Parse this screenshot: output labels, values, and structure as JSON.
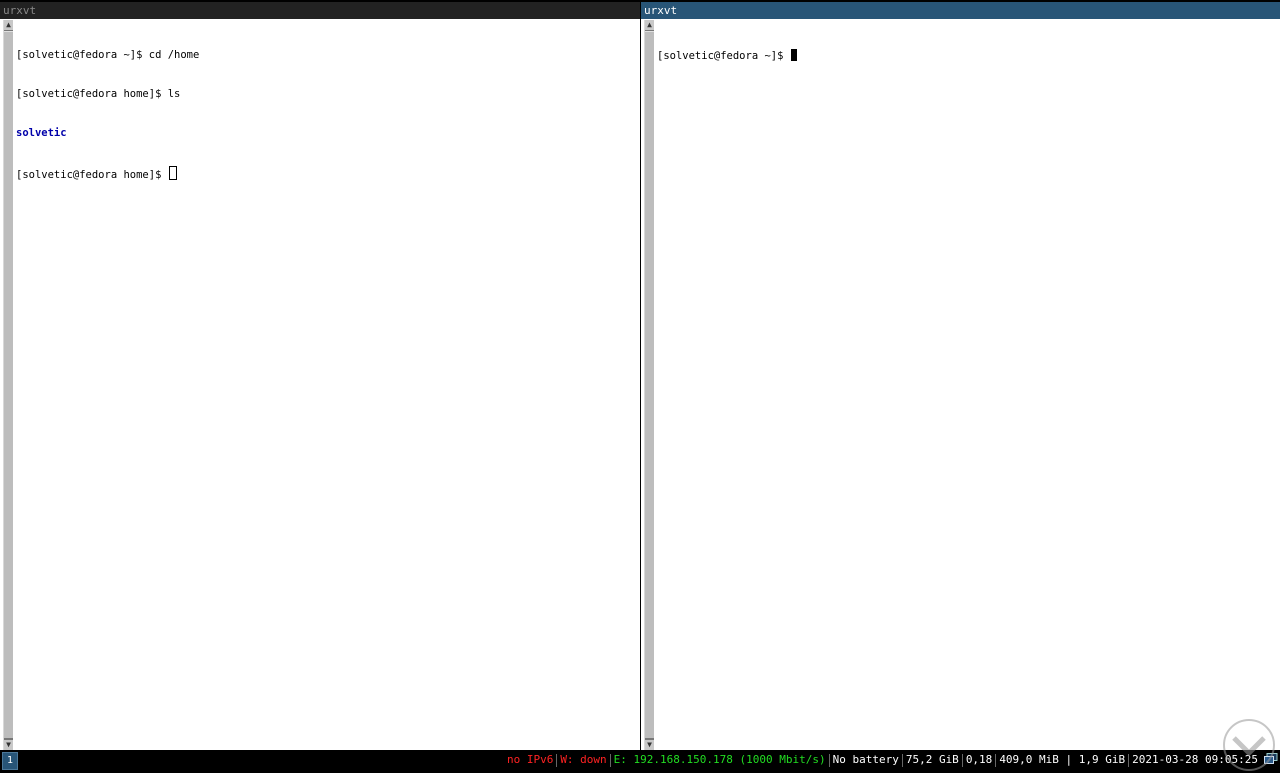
{
  "windows": {
    "left": {
      "title": "urxvt",
      "lines": {
        "l1": "[solvetic@fedora ~]$ cd /home",
        "l2": "[solvetic@fedora home]$ ls",
        "l3": "solvetic",
        "l4": "[solvetic@fedora home]$ "
      }
    },
    "right": {
      "title": "urxvt",
      "lines": {
        "l1": "[solvetic@fedora ~]$ "
      }
    }
  },
  "statusbar": {
    "workspace": "1",
    "ipv6": "no IPv6",
    "wireless": "W: down",
    "ethernet": "E: 192.168.150.178 (1000 Mbit/s)",
    "battery": "No battery",
    "disk": "75,2 GiB",
    "load": "0,18",
    "memory": "409,0 MiB | 1,9 GiB",
    "datetime": "2021-03-28 09:05:25"
  },
  "colors": {
    "active_title": "#285577",
    "inactive_title": "#222222",
    "status_error": "#ff2222",
    "status_ok": "#22dd22",
    "directory": "#0000aa"
  },
  "icons": {
    "tray": "network-tray-icon",
    "scroll_up": "arrow-up-icon",
    "scroll_down": "arrow-down-icon"
  }
}
